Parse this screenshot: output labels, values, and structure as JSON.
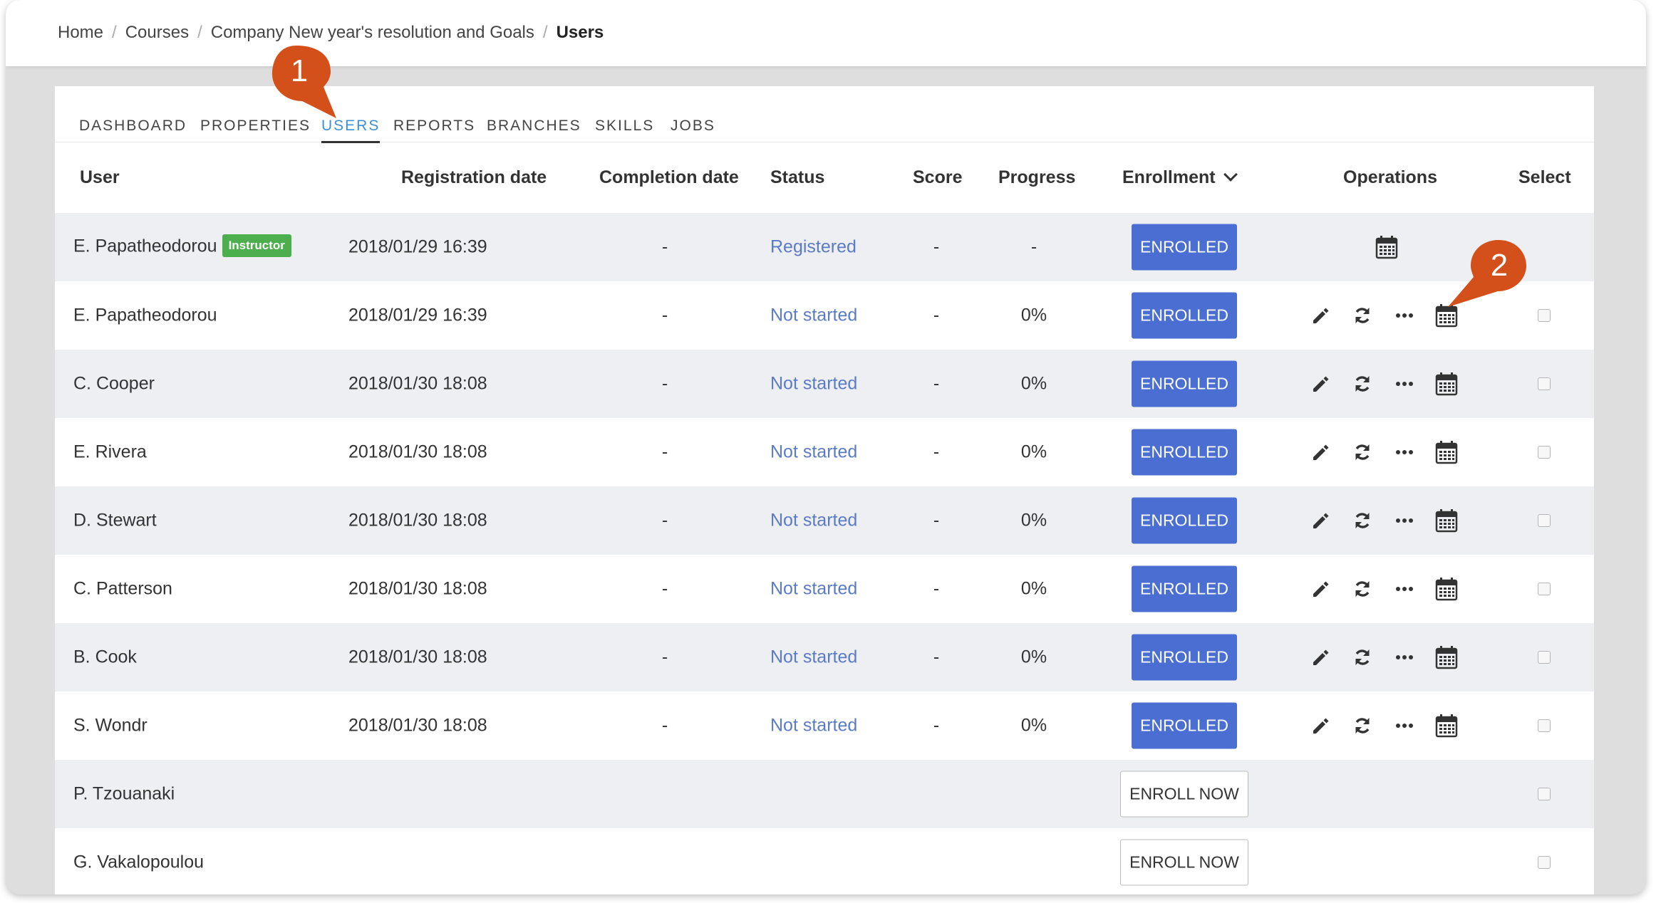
{
  "breadcrumb": {
    "items": [
      "Home",
      "Courses",
      "Company New year's resolution and Goals"
    ],
    "current": "Users"
  },
  "tabs": [
    {
      "label": "DASHBOARD",
      "active": false
    },
    {
      "label": "PROPERTIES",
      "active": false
    },
    {
      "label": "USERS",
      "active": true
    },
    {
      "label": "REPORTS",
      "active": false
    },
    {
      "label": "BRANCHES",
      "active": false
    },
    {
      "label": "SKILLS",
      "active": false
    },
    {
      "label": "JOBS",
      "active": false
    }
  ],
  "table": {
    "headers": {
      "user": "User",
      "registration": "Registration date",
      "completion": "Completion date",
      "status": "Status",
      "score": "Score",
      "progress": "Progress",
      "enrollment": "Enrollment",
      "operations": "Operations",
      "select": "Select"
    },
    "rows": [
      {
        "user": "E. Papatheodorou",
        "badge": "Instructor",
        "registration": "2018/01/29 16:39",
        "completion": "-",
        "status": "Registered",
        "score": "-",
        "progress": "-",
        "enrollment": "ENROLLED",
        "ops": "calendar-only",
        "select": false
      },
      {
        "user": "E. Papatheodorou",
        "badge": "",
        "registration": "2018/01/29 16:39",
        "completion": "-",
        "status": "Not started",
        "score": "-",
        "progress": "0%",
        "enrollment": "ENROLLED",
        "ops": "full",
        "select": true
      },
      {
        "user": "C. Cooper",
        "badge": "",
        "registration": "2018/01/30 18:08",
        "completion": "-",
        "status": "Not started",
        "score": "-",
        "progress": "0%",
        "enrollment": "ENROLLED",
        "ops": "full",
        "select": true
      },
      {
        "user": "E. Rivera",
        "badge": "",
        "registration": "2018/01/30 18:08",
        "completion": "-",
        "status": "Not started",
        "score": "-",
        "progress": "0%",
        "enrollment": "ENROLLED",
        "ops": "full",
        "select": true
      },
      {
        "user": "D. Stewart",
        "badge": "",
        "registration": "2018/01/30 18:08",
        "completion": "-",
        "status": "Not started",
        "score": "-",
        "progress": "0%",
        "enrollment": "ENROLLED",
        "ops": "full",
        "select": true
      },
      {
        "user": "C. Patterson",
        "badge": "",
        "registration": "2018/01/30 18:08",
        "completion": "-",
        "status": "Not started",
        "score": "-",
        "progress": "0%",
        "enrollment": "ENROLLED",
        "ops": "full",
        "select": true
      },
      {
        "user": "B. Cook",
        "badge": "",
        "registration": "2018/01/30 18:08",
        "completion": "-",
        "status": "Not started",
        "score": "-",
        "progress": "0%",
        "enrollment": "ENROLLED",
        "ops": "full",
        "select": true
      },
      {
        "user": "S. Wondr",
        "badge": "",
        "registration": "2018/01/30 18:08",
        "completion": "-",
        "status": "Not started",
        "score": "-",
        "progress": "0%",
        "enrollment": "ENROLLED",
        "ops": "full",
        "select": true
      },
      {
        "user": "P. Tzouanaki",
        "badge": "",
        "registration": "",
        "completion": "",
        "status": "",
        "score": "",
        "progress": "",
        "enrollment": "ENROLL NOW",
        "ops": "none",
        "select": true
      },
      {
        "user": "G. Vakalopoulou",
        "badge": "",
        "registration": "",
        "completion": "",
        "status": "",
        "score": "",
        "progress": "",
        "enrollment": "ENROLL NOW",
        "ops": "none",
        "select": true
      }
    ]
  },
  "callouts": [
    "1",
    "2"
  ],
  "colors": {
    "accent_tab": "#3d8fd6",
    "enrolled_button": "#4a6ed2",
    "status_link": "#5b7bc6",
    "instructor_badge": "#4cae4c",
    "callout": "#d4501a",
    "row_stripe": "#edeff3"
  },
  "icons": {
    "edit": "pencil-icon",
    "reset": "refresh-icon",
    "more": "ellipsis-icon",
    "calendar": "calendar-icon",
    "sort": "chevron-down-icon"
  }
}
